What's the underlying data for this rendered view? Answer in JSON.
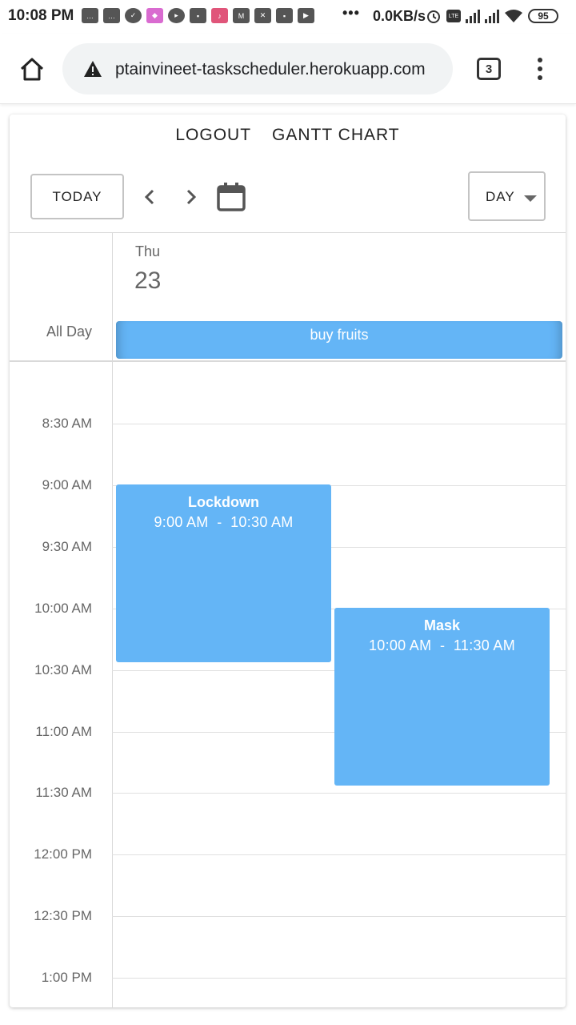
{
  "status_bar": {
    "time": "10:08 PM",
    "dots": "•••",
    "network_speed": "0.0KB/s",
    "battery": "95"
  },
  "browser": {
    "url": "ptainvineet-taskscheduler.herokuapp.com",
    "tab_count": "3"
  },
  "nav": {
    "logout": "LOGOUT",
    "gantt_chart": "GANTT CHART"
  },
  "toolbar": {
    "today_label": "TODAY",
    "view_selected": "DAY"
  },
  "day": {
    "name": "Thu",
    "number": "23"
  },
  "all_day": {
    "label": "All Day",
    "event_title": "buy fruits"
  },
  "time_slots": [
    "8:30 AM",
    "9:00 AM",
    "9:30 AM",
    "10:00 AM",
    "10:30 AM",
    "11:00 AM",
    "11:30 AM",
    "12:00 PM",
    "12:30 PM",
    "1:00 PM"
  ],
  "events": [
    {
      "title": "Lockdown",
      "time": "9:00 AM  -  10:30 AM"
    },
    {
      "title": "Mask",
      "time": "10:00 AM  -  11:30 AM"
    }
  ],
  "colors": {
    "event_blue": "#64b5f6",
    "grid_line": "#e0e0e0"
  }
}
